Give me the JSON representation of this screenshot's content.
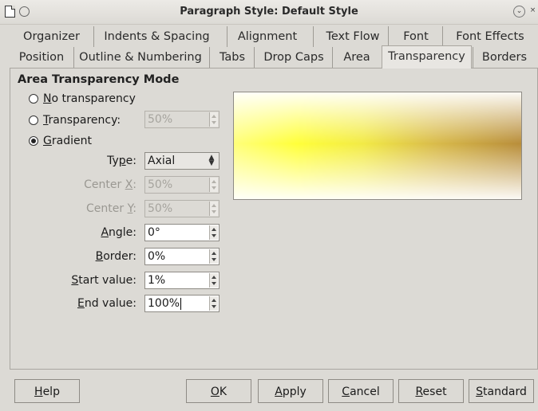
{
  "window": {
    "title": "Paragraph Style: Default Style",
    "minimize_glyph": "⌄",
    "close_glyph": "×"
  },
  "tabs_row1": [
    "Organizer",
    "Indents & Spacing",
    "Alignment",
    "Text Flow",
    "Font",
    "Font Effects"
  ],
  "tabs_row2": [
    "Position",
    "Outline & Numbering",
    "Tabs",
    "Drop Caps",
    "Area",
    "Transparency",
    "Borders"
  ],
  "active_tab": "Transparency",
  "section": {
    "title": "Area Transparency Mode"
  },
  "radios": {
    "no_transparency": {
      "label": "No transparency",
      "accel": "N",
      "rest": "o transparency",
      "selected": false
    },
    "transparency": {
      "label": "Transparency:",
      "accel": "T",
      "rest": "ransparency:",
      "selected": false
    },
    "gradient": {
      "label": "Gradient",
      "accel": "G",
      "rest": "radient",
      "selected": true
    }
  },
  "transparency_value": "50%",
  "fields": {
    "type": {
      "label_pre": "Ty",
      "accel": "p",
      "label_post": "e:",
      "value": "Axial"
    },
    "center_x": {
      "label_pre": "Center ",
      "accel": "X",
      "label_post": ":",
      "value": "50%"
    },
    "center_y": {
      "label_pre": "Center ",
      "accel": "Y",
      "label_post": ":",
      "value": "50%"
    },
    "angle": {
      "label_pre": "",
      "accel": "A",
      "label_post": "ngle:",
      "value": "0°"
    },
    "border": {
      "label_pre": "",
      "accel": "B",
      "label_post": "order:",
      "value": "0%"
    },
    "start_value": {
      "label_pre": "",
      "accel": "S",
      "label_post": "tart value:",
      "value": "1%"
    },
    "end_value": {
      "label_pre": "",
      "accel": "E",
      "label_post": "nd value:",
      "value": "100%"
    }
  },
  "buttons": {
    "help": {
      "accel": "H",
      "rest": "elp"
    },
    "ok": {
      "accel": "O",
      "rest": "K"
    },
    "apply": {
      "accel": "A",
      "rest": "pply"
    },
    "cancel": {
      "accel": "C",
      "rest": "ancel"
    },
    "reset": {
      "accel": "R",
      "rest": "eset"
    },
    "standard": {
      "accel": "S",
      "rest": "tandard"
    }
  },
  "preview_colors": [
    "#ffff3a",
    "#b88d3a"
  ]
}
